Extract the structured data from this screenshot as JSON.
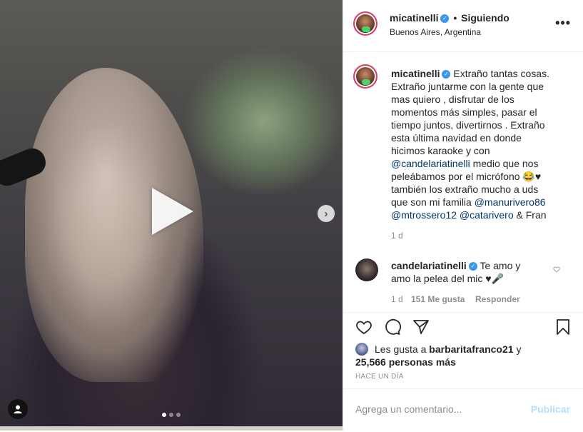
{
  "post": {
    "username": "micatinelli",
    "follow_status": "Siguiendo",
    "separator": "•",
    "location": "Buenos Aires, Argentina",
    "more_label": "•••"
  },
  "media": {
    "play_icon": "play-icon",
    "next_icon": "chevron-right-icon",
    "next_glyph": "›",
    "user_tag_icon": "user-icon",
    "carousel_count": 3,
    "carousel_active": 1
  },
  "caption": {
    "username": "micatinelli",
    "text_part1": "Extraño tantas cosas. Extraño juntarme con la gente que mas quiero , disfrutar de los momentos más simples, pasar el tiempo juntos, divertirnos . Extraño esta última navidad en donde hicimos karaoke y con",
    "mention1": "@candelariatinelli",
    "text_part2": "medio que nos peleábamos por el micrófono 😂♥ también los extraño mucho a uds que son mi familia",
    "mention2": "@manurivero86",
    "mention3": "@mtrossero12",
    "mention4": "@catarivero",
    "text_part3": "& Fran",
    "time": "1 d"
  },
  "comment": {
    "username": "candelariatinelli",
    "text": "Te amo y amo la pelea del mic ♥🎤",
    "time": "1 d",
    "likes": "151 Me gusta",
    "reply": "Responder"
  },
  "actions": {
    "likes_prefix": "Les gusta a",
    "liker": "barbaritafranco21",
    "and": "y",
    "others": "25,566 personas más",
    "time_ago": "HACE UN DÍA"
  },
  "comment_box": {
    "placeholder": "Agrega un comentario...",
    "publish": "Publicar"
  },
  "colors": {
    "accent": "#3897f0",
    "mention": "#00376b",
    "muted": "#8e8e8e",
    "publish_disabled": "#b2dffc"
  }
}
